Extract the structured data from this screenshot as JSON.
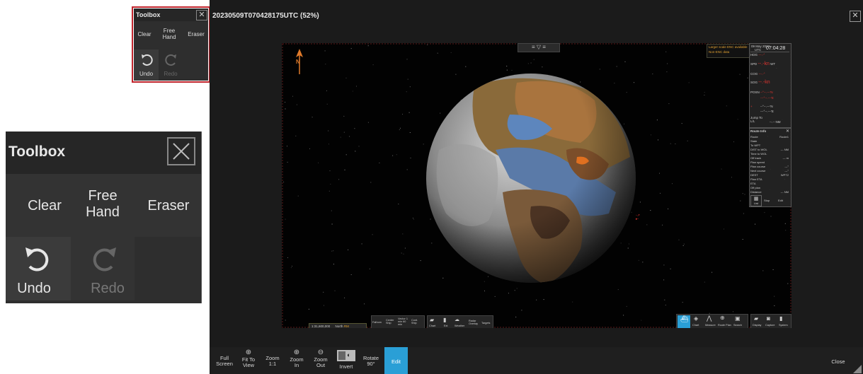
{
  "toolbox": {
    "title": "Toolbox",
    "close_glyph": "✕",
    "clear_label": "Clear",
    "free_hand_label_line1": "Free",
    "free_hand_label_line2": "Hand",
    "eraser_label": "Eraser",
    "undo_label": "Undo",
    "redo_label": "Redo"
  },
  "window": {
    "title": "20230509T070428175UTC (52%)",
    "close_glyph": "✕"
  },
  "chart": {
    "north_label": "N",
    "enc_notice_line1": "Larger scale ENC available",
    "enc_notice_line2": "Non-ENC data",
    "time_date_line1": "09 May 2023",
    "time_zone": "UTC",
    "time_value": "07:04:28",
    "hdg_label": "HDG",
    "hdg_value": "---.-°",
    "spd_label": "SPD",
    "spd_value": "--.-kn",
    "spd_unit": "WT",
    "cog_label": "COG",
    "cog_value": "---.-°",
    "sog_label": "SOG",
    "sog_value": "--.-kn",
    "posn_label": "POSN",
    "posn_lat": "--°--.---'N",
    "posn_lon": "---°--.---'E",
    "cursor_lat": "--°--.---'N",
    "cursor_lon": "---°--.---'E",
    "jump_to_label": "Jump To",
    "ll_label": "L/L",
    "cursor_dist": "--.-- NM",
    "route_info_title": "Route Info",
    "route_rows": [
      {
        "k": "Route",
        "v": "Route1"
      },
      {
        "k": "State",
        "v": ""
      },
      {
        "k": "To WPT",
        "v": ""
      },
      {
        "k": "DIST to WOL",
        "v": "--- NM"
      },
      {
        "k": "Time to WOL",
        "v": ""
      },
      {
        "k": "Off track",
        "v": "--- m"
      },
      {
        "k": "Plan speed",
        "v": ""
      },
      {
        "k": "Plan course",
        "v": "---°"
      },
      {
        "k": "Next course",
        "v": "---°"
      },
      {
        "k": "DEST",
        "v": "WPT2"
      },
      {
        "k": "Plan ETA",
        "v": ""
      },
      {
        "k": "ETA",
        "v": ""
      },
      {
        "k": "Off plan",
        "v": ""
      },
      {
        "k": "Distance",
        "v": "--- NM"
      }
    ],
    "route_list_label": "List",
    "route_stop_label": "Stop",
    "route_edit_label": "Edit",
    "scale_value": "1:31,600,000",
    "orientation": "North",
    "mode": "RM",
    "bottom_tool_labels": [
      "Fathom",
      "Center Ship",
      "Vector 1 min 60 min",
      "Cont. Ship"
    ],
    "bottom_icon_labels": [
      "Chart",
      "Ext",
      "Weather",
      "Radar Overlay",
      "Targets"
    ],
    "right_icon_labels": [
      "Ship",
      "Chart",
      "Measure",
      "Route Plan",
      "Search"
    ],
    "far_right_labels": [
      "Display",
      "Capture",
      "System"
    ]
  },
  "bottom_bar": {
    "full_screen": [
      "Full",
      "Screen"
    ],
    "fit_to_view": [
      "Fit To",
      "View"
    ],
    "zoom_1_1": [
      "Zoom",
      "1:1"
    ],
    "zoom_in": [
      "Zoom",
      "In"
    ],
    "zoom_out": [
      "Zoom",
      "Out"
    ],
    "invert": "Invert",
    "rotate": [
      "Rotate",
      "90°"
    ],
    "edit": "Edit",
    "close": "Close"
  },
  "colors": {
    "highlight_border": "#c0242c",
    "edit_button": "#2a9fd6",
    "alert_red": "#e0342f",
    "notice_orange": "#e0a030"
  }
}
